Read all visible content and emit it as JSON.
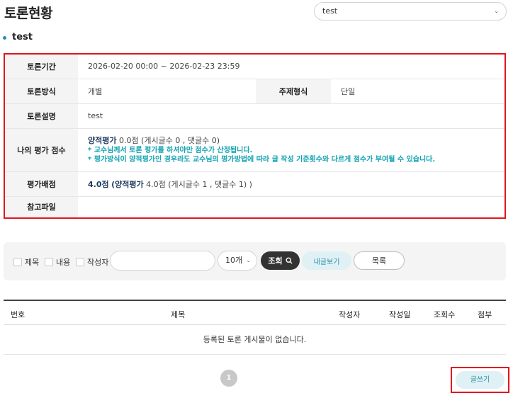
{
  "page": {
    "title": "토론현황"
  },
  "topic_select": {
    "value": "test"
  },
  "discussion": {
    "title": "test"
  },
  "info": {
    "period_label": "토론기간",
    "period_value": "2026-02-20 00:00 ~ 2026-02-23 23:59",
    "method_label": "토론방식",
    "method_value": "개별",
    "topic_type_label": "주제형식",
    "topic_type_value": "단일",
    "desc_label": "토론설명",
    "desc_value": "test",
    "my_score_label": "나의 평가 점수",
    "my_score_kind": "양적평가",
    "my_score_value": "0.0점",
    "my_score_counts": "(게시글수 0 , 댓글수 0)",
    "notice_1": "* 교수님께서 토론 평가를 하셔야만 점수가 산정됩니다.",
    "notice_2": "* 평가방식이 양적평가인 경우라도 교수님의 평가방법에 따라 글 작성 기준횟수와 다르게 점수가 부여될 수 있습니다.",
    "allot_label": "평가배점",
    "allot_total": "4.0점",
    "allot_open": "(",
    "allot_kind": "양적평가",
    "allot_detail": "4.0점 (게시글수 1 , 댓글수 1) )",
    "file_label": "참고파일",
    "file_value": ""
  },
  "search": {
    "chk_title": "제목",
    "chk_content": "내용",
    "chk_author": "작성자",
    "keyword": "",
    "count_value": "10개",
    "search_button": "조회",
    "my_posts_button": "내글보기",
    "list_button": "목록"
  },
  "board": {
    "columns": [
      "번호",
      "제목",
      "작성자",
      "작성일",
      "조회수",
      "첨부"
    ],
    "empty_message": "등록된 토론 게시물이 없습니다."
  },
  "pagination": {
    "current": "1"
  },
  "write_button": "글쓰기"
}
